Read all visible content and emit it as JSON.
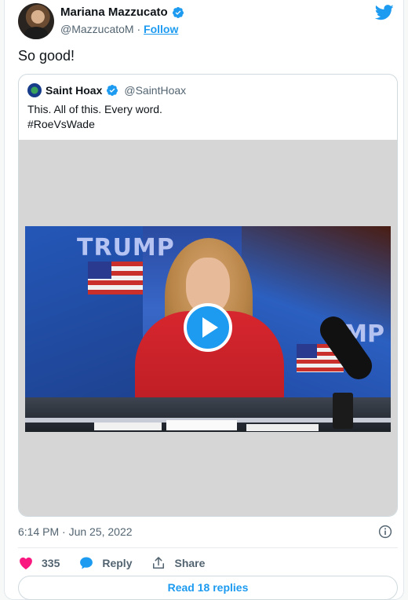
{
  "author": {
    "name": "Mariana Mazzucato",
    "handle": "@MazzucatoM",
    "separator": " · ",
    "follow_label": "Follow"
  },
  "tweet": {
    "text": "So good!"
  },
  "quoted": {
    "name": "Saint Hoax",
    "handle": "@SaintHoax",
    "line1": "This. All of this. Every word.",
    "line2": "#RoeVsWade"
  },
  "meta": {
    "timestamp": "6:14 PM · Jun 25, 2022"
  },
  "actions": {
    "like_count": "335",
    "reply_label": "Reply",
    "share_label": "Share"
  },
  "footer": {
    "read_replies_label": "Read 18 replies"
  },
  "colors": {
    "accent": "#1d9bf0",
    "like": "#f91880",
    "muted": "#536471"
  },
  "icons": [
    "verified-badge-icon",
    "twitter-logo-icon",
    "play-icon",
    "info-icon",
    "heart-icon",
    "reply-bubble-icon",
    "share-icon"
  ]
}
